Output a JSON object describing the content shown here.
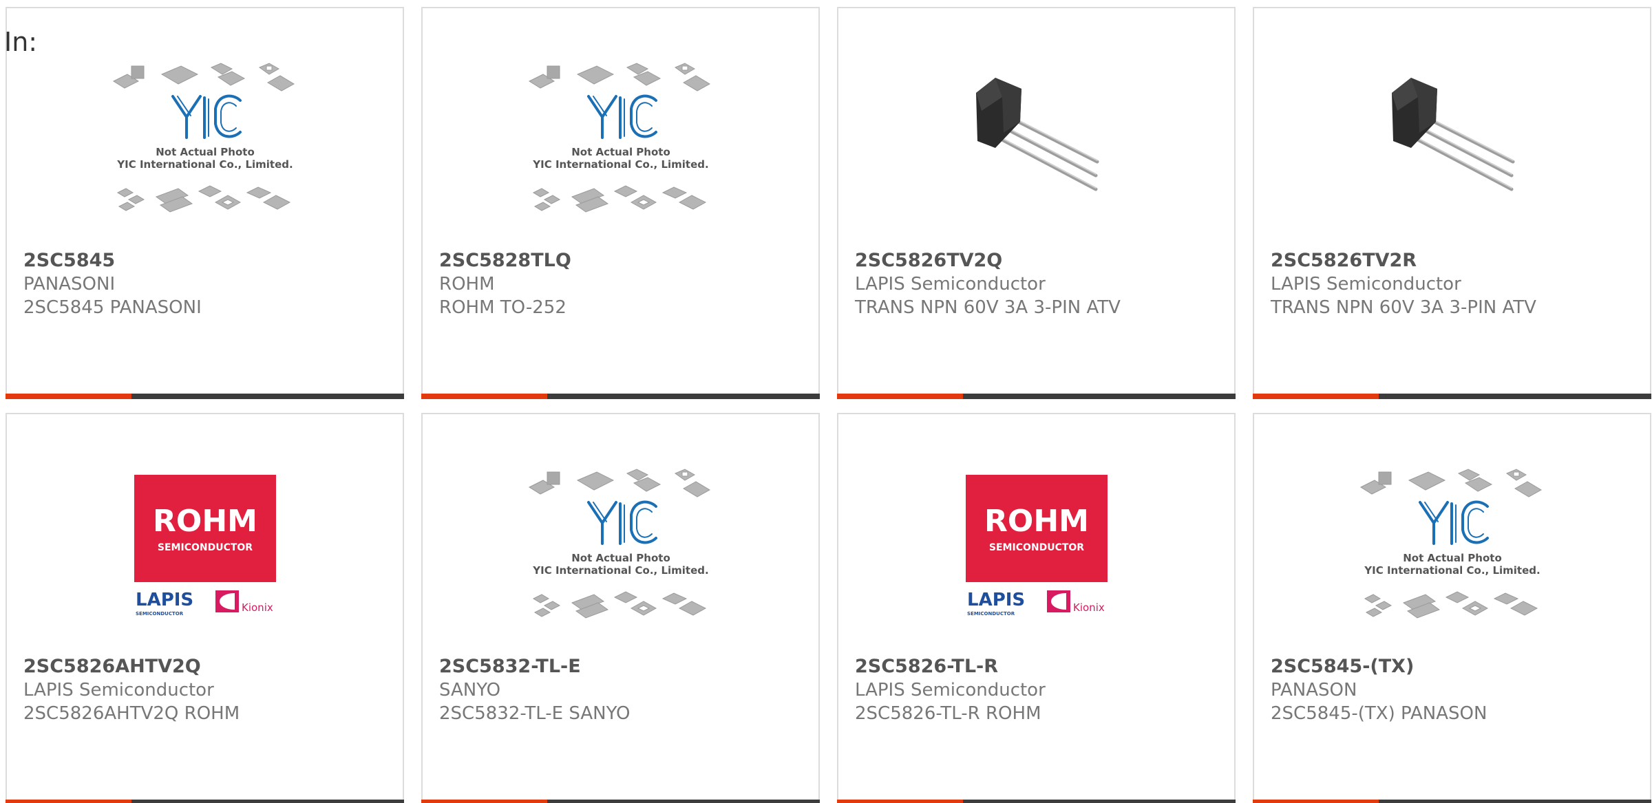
{
  "filter_label": "In:",
  "placeholder_image": {
    "line1": "Not Actual Photo",
    "line2": "YIC International Co., Limited."
  },
  "logo_image": {
    "brand": "ROHM",
    "sub": "SEMICONDUCTOR",
    "lapis": "LAPIS",
    "lapis_sub": "SEMICONDUCTOR",
    "kionix": "Kionix"
  },
  "colors": {
    "accent": "#e23a0e",
    "bar": "#3c3c3c",
    "rohm_red": "#e0203e",
    "lapis_blue": "#1f4f9c",
    "yic_blue": "#1a6fb5"
  },
  "products": [
    {
      "part_number": "2SC5845",
      "manufacturer": "PANASONI",
      "description": "2SC5845 PANASONI",
      "image": "yic-placeholder"
    },
    {
      "part_number": "2SC5828TLQ",
      "manufacturer": "ROHM",
      "description": "ROHM TO-252",
      "image": "yic-placeholder"
    },
    {
      "part_number": "2SC5826TV2Q",
      "manufacturer": "LAPIS Semiconductor",
      "description": "TRANS NPN 60V 3A 3-PIN ATV",
      "image": "transistor-photo"
    },
    {
      "part_number": "2SC5826TV2R",
      "manufacturer": "LAPIS Semiconductor",
      "description": "TRANS NPN 60V 3A 3-PIN ATV",
      "image": "transistor-photo"
    },
    {
      "part_number": "2SC5826AHTV2Q",
      "manufacturer": "LAPIS Semiconductor",
      "description": "2SC5826AHTV2Q ROHM",
      "image": "rohm-logo"
    },
    {
      "part_number": "2SC5832-TL-E",
      "manufacturer": "SANYO",
      "description": "2SC5832-TL-E SANYO",
      "image": "yic-placeholder"
    },
    {
      "part_number": "2SC5826-TL-R",
      "manufacturer": "LAPIS Semiconductor",
      "description": "2SC5826-TL-R ROHM",
      "image": "rohm-logo"
    },
    {
      "part_number": "2SC5845-(TX)",
      "manufacturer": "PANASON",
      "description": "2SC5845-(TX) PANASON",
      "image": "yic-placeholder"
    }
  ]
}
